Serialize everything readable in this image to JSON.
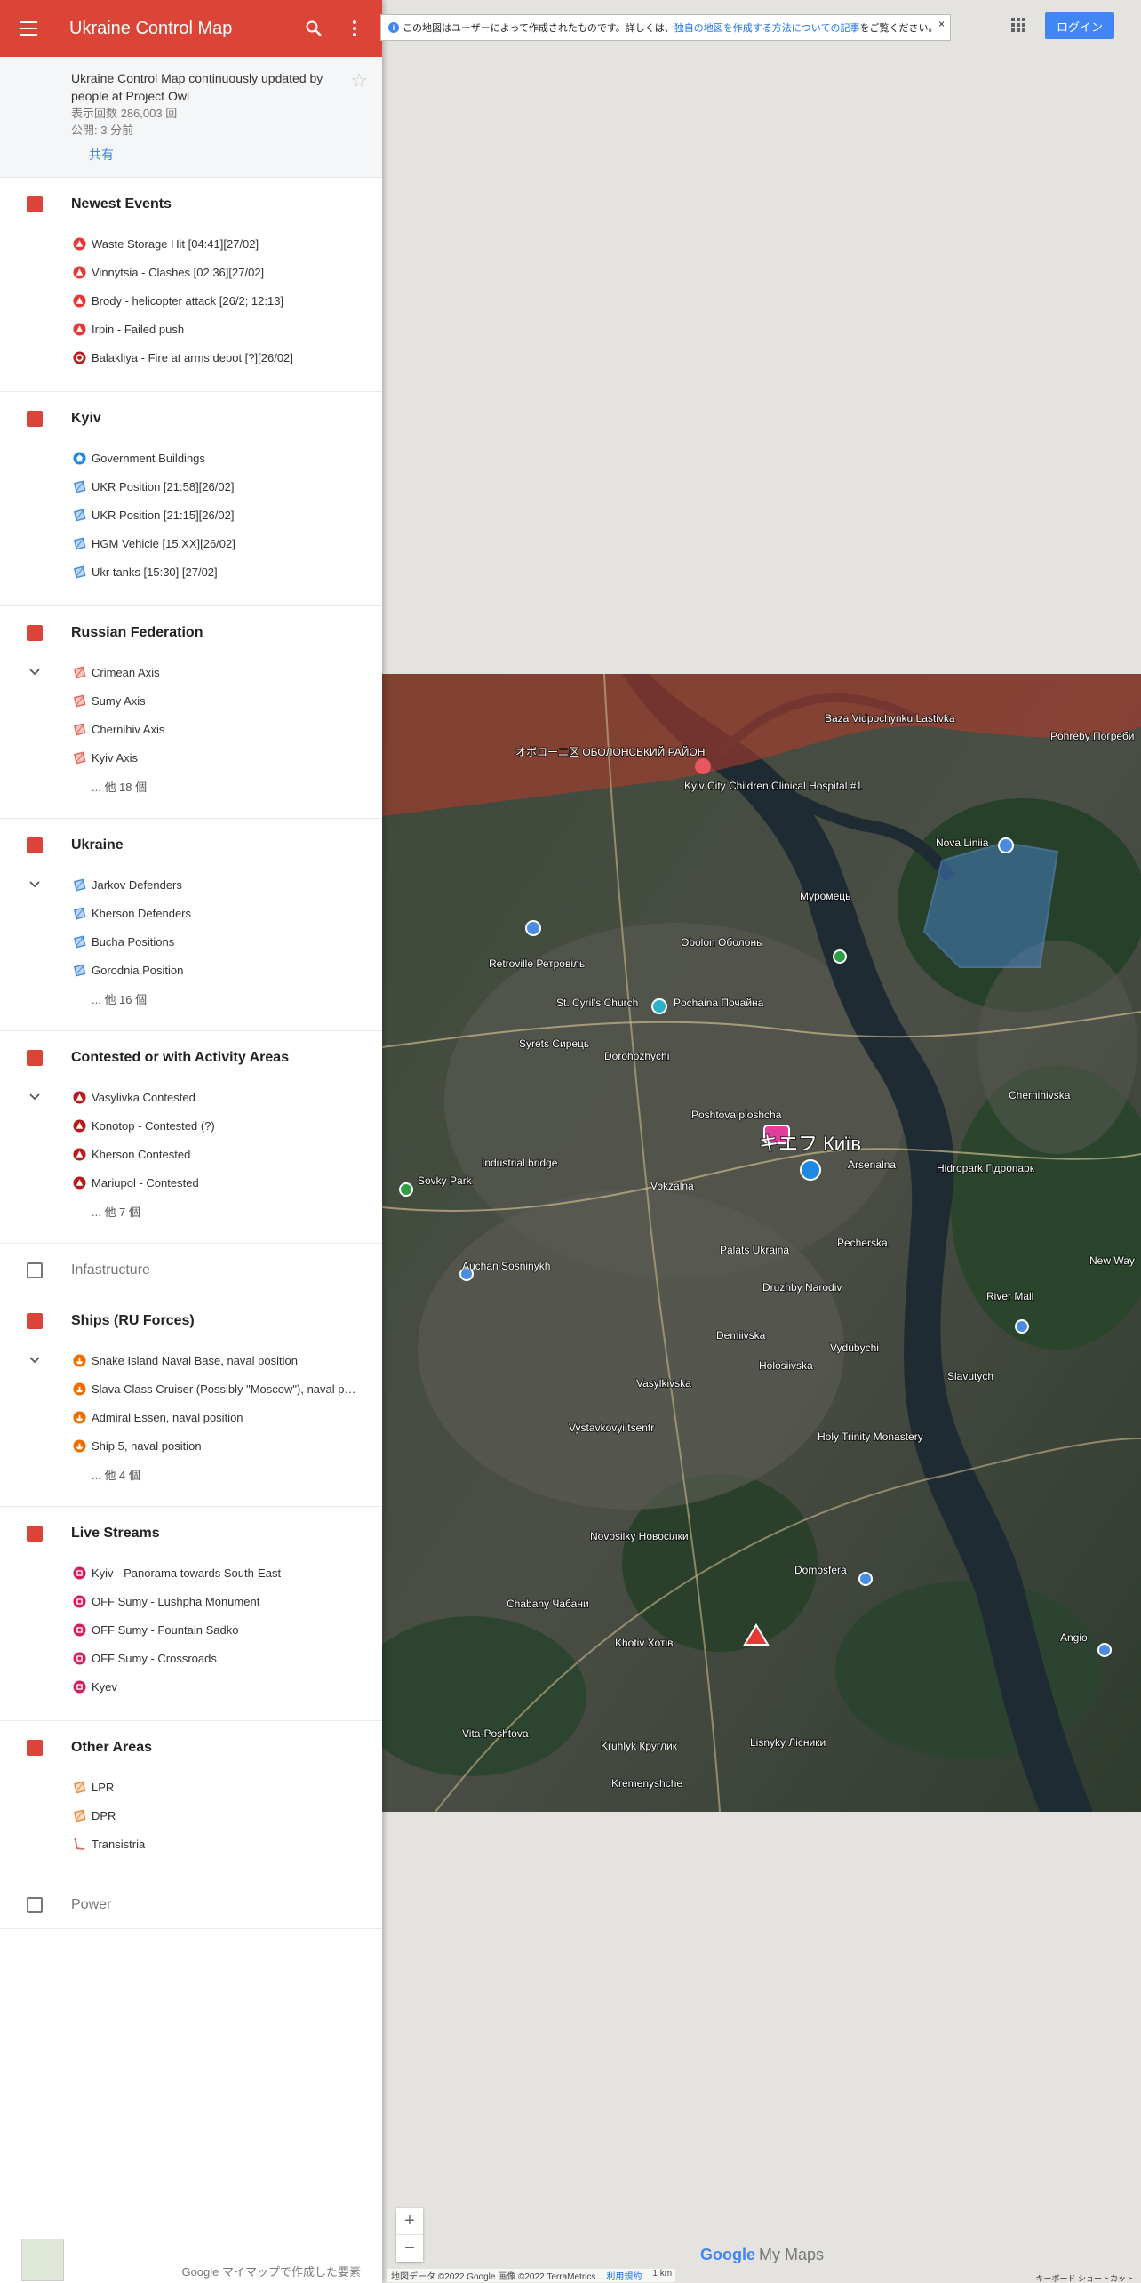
{
  "app": {
    "title": "Ukraine Control Map"
  },
  "map_info": {
    "description": "Ukraine Control Map continuously updated by people at Project Owl",
    "views": "表示回数 286,003 回",
    "published": "公開: 3 分前",
    "share": "共有"
  },
  "layers": [
    {
      "name": "Newest Events",
      "checked": true,
      "items": [
        {
          "label": "Waste Storage Hit [04:41][27/02]",
          "icon": "red-triangle"
        },
        {
          "label": "Vinnytsia - Clashes [02:36][27/02]",
          "icon": "red-triangle"
        },
        {
          "label": "Brody - helicopter attack [26/2; 12:13]",
          "icon": "red-triangle"
        },
        {
          "label": "Irpin - Failed push",
          "icon": "red-triangle"
        },
        {
          "label": "Balakliya - Fire at arms depot [?][26/02]",
          "icon": "red-ring"
        }
      ]
    },
    {
      "name": "Kyiv",
      "checked": true,
      "items": [
        {
          "label": "Government Buildings",
          "icon": "blue-house"
        },
        {
          "label": "UKR Position [21:58][26/02]",
          "icon": "blue-polygon"
        },
        {
          "label": "UKR Position [21:15][26/02]",
          "icon": "blue-polygon"
        },
        {
          "label": "HGM Vehicle [15.XX][26/02]",
          "icon": "blue-polygon"
        },
        {
          "label": "Ukr tanks [15:30] [27/02]",
          "icon": "blue-polygon"
        }
      ]
    },
    {
      "name": "Russian Federation",
      "checked": true,
      "collapsible": true,
      "items": [
        {
          "label": "Crimean Axis",
          "icon": "red-polygon"
        },
        {
          "label": "Sumy Axis",
          "icon": "red-polygon"
        },
        {
          "label": "Chernihiv Axis",
          "icon": "red-polygon"
        },
        {
          "label": "Kyiv Axis",
          "icon": "red-polygon"
        }
      ],
      "more": "... 他 18 個"
    },
    {
      "name": "Ukraine",
      "checked": true,
      "collapsible": true,
      "items": [
        {
          "label": "Jarkov Defenders",
          "icon": "blue-polygon"
        },
        {
          "label": "Kherson Defenders",
          "icon": "blue-polygon"
        },
        {
          "label": "Bucha Positions",
          "icon": "blue-polygon"
        },
        {
          "label": "Gorodnia Position",
          "icon": "blue-polygon"
        }
      ],
      "more": "... 他 16 個"
    },
    {
      "name": "Contested or with Activity Areas",
      "checked": true,
      "collapsible": true,
      "items": [
        {
          "label": "Vasylivka Contested",
          "icon": "darkred-triangle"
        },
        {
          "label": "Konotop - Contested (?)",
          "icon": "darkred-triangle"
        },
        {
          "label": "Kherson Contested",
          "icon": "darkred-triangle"
        },
        {
          "label": "Mariupol - Contested",
          "icon": "darkred-triangle"
        }
      ],
      "more": "... 他 7 個"
    },
    {
      "name": "Infastructure",
      "checked": false,
      "items": []
    },
    {
      "name": "Ships (RU Forces)",
      "checked": true,
      "collapsible": true,
      "items": [
        {
          "label": "Snake Island Naval Base, naval position",
          "icon": "orange-ship"
        },
        {
          "label": "Slava Class Cruiser (Possibly \"Moscow\"), naval position",
          "icon": "orange-ship"
        },
        {
          "label": "Admiral Essen, naval position",
          "icon": "orange-ship"
        },
        {
          "label": "Ship 5, naval position",
          "icon": "orange-ship"
        }
      ],
      "more": "... 他 4 個"
    },
    {
      "name": "Live Streams",
      "checked": true,
      "items": [
        {
          "label": "Kyiv - Panorama towards South-East",
          "icon": "pink-camera"
        },
        {
          "label": "OFF Sumy - Lushpha Monument",
          "icon": "pink-camera"
        },
        {
          "label": "OFF Sumy - Fountain Sadko",
          "icon": "pink-camera"
        },
        {
          "label": "OFF Sumy - Crossroads",
          "icon": "pink-camera"
        },
        {
          "label": "Kyev",
          "icon": "pink-camera"
        }
      ]
    },
    {
      "name": "Other Areas",
      "checked": true,
      "items": [
        {
          "label": "LPR",
          "icon": "orange-polygon"
        },
        {
          "label": "DPR",
          "icon": "orange-polygon"
        },
        {
          "label": "Transistria",
          "icon": "red-line"
        }
      ]
    },
    {
      "name": "Power",
      "checked": false,
      "items": []
    }
  ],
  "footer": {
    "made_with": "Google マイマップで作成した要素"
  },
  "map": {
    "notice": {
      "text": "この地図はユーザーによって作成されたものです。詳しくは、",
      "link": "独自の地図を作成する方法についての記事",
      "suffix": "をご覧ください。",
      "close": "×"
    },
    "login": "ログイン",
    "zoom_in": "+",
    "zoom_out": "−",
    "branding_google": "Google",
    "branding_mymaps": "My Maps",
    "attribution": "地図データ ©2022 Google 画像 ©2022 TerraMetrics",
    "terms": "利用規約",
    "scale": "1 km",
    "shortcuts": "キーボード ショートカット",
    "labels": [
      {
        "text": "Kyiv City Children Clinical Hospital #1"
      },
      {
        "text": "Baza Vidpochynku Lastivka"
      },
      {
        "text": "Pohreby Погреби"
      },
      {
        "text": "オボローニ区 ОБОЛОНСЬКИЙ РАЙОН"
      },
      {
        "text": "Nova Liniia"
      },
      {
        "text": "Муромець"
      },
      {
        "text": "Obolon Оболонь"
      },
      {
        "text": "Retroville Ретровіль"
      },
      {
        "text": "St. Cyril's Church"
      },
      {
        "text": "Pochaina Почайна"
      },
      {
        "text": "Syrets Сирець"
      },
      {
        "text": "Dorohozhychi"
      },
      {
        "text": "Poshtova ploshcha"
      },
      {
        "text": "キエフ Київ"
      },
      {
        "text": "Arsenalna"
      },
      {
        "text": "Hidropark Гідропарк"
      },
      {
        "text": "Chernihivska"
      },
      {
        "text": "Industrial bridge"
      },
      {
        "text": "Sovky Park"
      },
      {
        "text": "Vokzalna"
      },
      {
        "text": "Palats Ukraina"
      },
      {
        "text": "Pecherska"
      },
      {
        "text": "Auchan Sosninykh"
      },
      {
        "text": "Druzhby Narodiv"
      },
      {
        "text": "Demiivska"
      },
      {
        "text": "Holosiivska"
      },
      {
        "text": "Vydubychi"
      },
      {
        "text": "Slavutych"
      },
      {
        "text": "River Mall"
      },
      {
        "text": "Vasylkivska"
      },
      {
        "text": "Vystavkovyi tsentr"
      },
      {
        "text": "Holy Trinity Monastery"
      },
      {
        "text": "Novosilky Новосілки"
      },
      {
        "text": "Domosfera"
      },
      {
        "text": "Chabany Чабани"
      },
      {
        "text": "Khotiv Хотів"
      },
      {
        "text": "Vita-Poshtova"
      },
      {
        "text": "Kruhlyk Круглик"
      },
      {
        "text": "Kremenyshche"
      },
      {
        "text": "Lisnyky Лісники"
      },
      {
        "text": "Angio"
      },
      {
        "text": "New Way"
      }
    ]
  }
}
